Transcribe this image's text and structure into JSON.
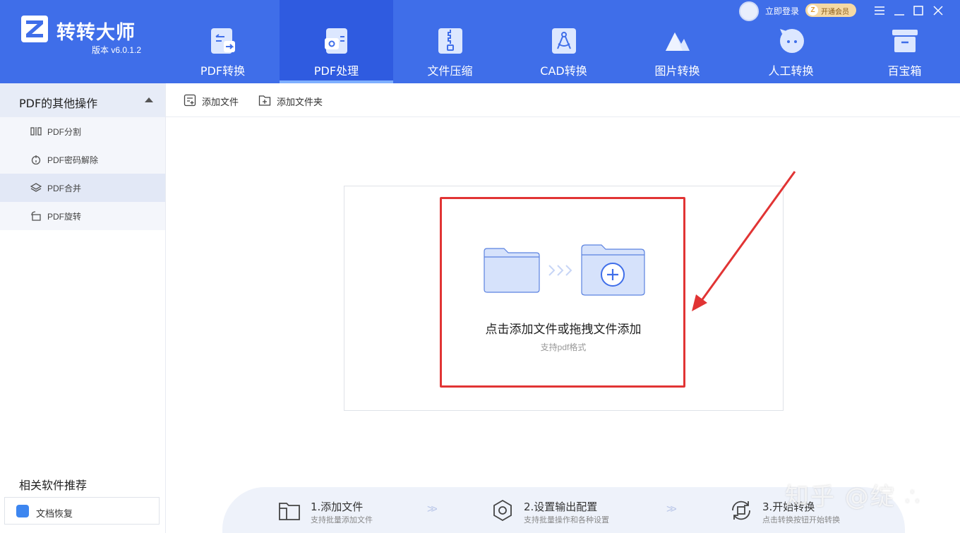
{
  "app": {
    "name": "转转大师",
    "version": "版本 v6.0.1.2"
  },
  "nav": {
    "tabs": [
      {
        "label": "PDF转换",
        "icon": "pdf-convert-icon"
      },
      {
        "label": "PDF处理",
        "icon": "pdf-process-icon",
        "active": true
      },
      {
        "label": "文件压缩",
        "icon": "zip-icon"
      },
      {
        "label": "CAD转换",
        "icon": "cad-icon"
      },
      {
        "label": "图片转换",
        "icon": "image-icon"
      },
      {
        "label": "人工转换",
        "icon": "chat-icon"
      },
      {
        "label": "百宝箱",
        "icon": "toolbox-icon"
      }
    ]
  },
  "account": {
    "login": "立即登录",
    "vip": "开通会员",
    "vip_badge_letter": "Z"
  },
  "sidebar": {
    "section_title": "PDF的其他操作",
    "items": [
      {
        "label": "PDF分割",
        "icon": "split-icon"
      },
      {
        "label": "PDF密码解除",
        "icon": "unlock-icon"
      },
      {
        "label": "PDF合并",
        "icon": "layers-icon",
        "active": true
      },
      {
        "label": "PDF旋转",
        "icon": "rotate-icon"
      }
    ],
    "recommend_title": "相关软件推荐",
    "recommend_item": "文档恢复"
  },
  "toolbar": {
    "add_file": "添加文件",
    "add_folder": "添加文件夹"
  },
  "dropzone": {
    "main_text": "点击添加文件或拖拽文件添加",
    "sub_text": "支持pdf格式"
  },
  "steps": [
    {
      "title": "1.添加文件",
      "desc": "支持批量添加文件"
    },
    {
      "title": "2.设置输出配置",
      "desc": "支持批量操作和各种设置"
    },
    {
      "title": "3.开始转换",
      "desc": "点击转换按钮开始转换"
    }
  ],
  "watermark": "知乎 @绽 ∴",
  "colors": {
    "header_bg": "#3f6ee9",
    "active_tab_bg": "#2f5be0",
    "highlight_red": "#e13434",
    "folder_blue": "#d6e2fb"
  }
}
